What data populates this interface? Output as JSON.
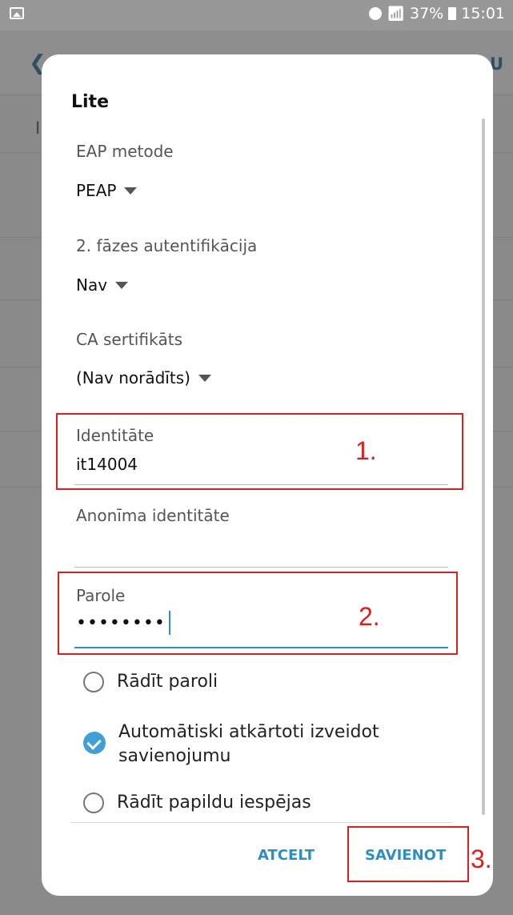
{
  "status_bar": {
    "icons": [
      "gallery-icon",
      "alarm-icon",
      "wifi-icon",
      "signal-icon",
      "battery-icon"
    ],
    "battery": "37%",
    "time": "15:01"
  },
  "background": {
    "advanced_label": "DU",
    "row_left": "I",
    "row_right": ")"
  },
  "dialog": {
    "title": "Lite",
    "eap_method_label": "EAP metode",
    "eap_method_value": "PEAP",
    "phase2_label": "2. fāzes autentifikācija",
    "phase2_value": "Nav",
    "ca_label": "CA sertifikāts",
    "ca_value": "(Nav norādīts)",
    "identity_label": "Identitāte",
    "identity_value": "it14004",
    "anon_label": "Anonīma identitāte",
    "anon_value": "",
    "password_label": "Parole",
    "password_value": "••••••••",
    "show_password": "Rādīt paroli",
    "auto_reconnect": "Automātiski atkārtoti izveidot savienojumu",
    "show_advanced": "Rādīt papildu iespējas",
    "cancel": "ATCELT",
    "connect": "SAVIENOT"
  },
  "annotations": {
    "n1": "1.",
    "n2": "2.",
    "n3": "3.",
    "color": "#e31b1b"
  },
  "colors": {
    "accent": "#2a8fc9"
  }
}
